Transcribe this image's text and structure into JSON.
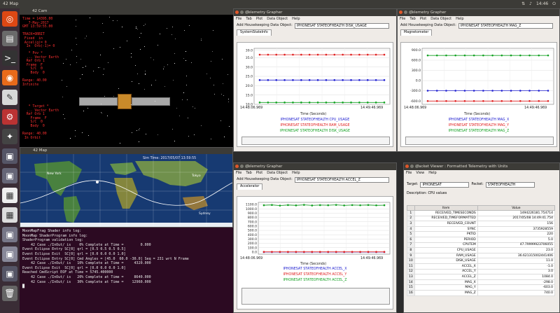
{
  "topbar": {
    "title": "42 Map",
    "clock": "14:46"
  },
  "colors": {
    "cpu": "#2020d0",
    "ram": "#e02020",
    "disk": "#10a020",
    "launcher": "#3a2d36",
    "terminal": "#2c0a22",
    "map_sea": "#173a72"
  },
  "launcher": {
    "icons": [
      "ubuntu-logo-icon",
      "files-icon",
      "terminal-icon",
      "firefox-icon",
      "text-editor-icon",
      "settings-icon",
      "tools-icon",
      "app-icon",
      "app-icon",
      "chart-icon",
      "chart-icon",
      "app-icon",
      "app-icon",
      "app-icon",
      "trash-icon"
    ]
  },
  "cam": {
    "title": "42 Cam",
    "hud_top": "Time = 14395.00\n   7-May-2017\nGMT 13:59:55.00\n\nTRACK=ORBIT\n Fixed  in\n Accel(g)= 0\n  In  Orb(-1)= 0",
    "hud_mid": "   * Pov *\n  ... Vector Earth\n  Ref Orb 1\n  Frame  F\n    S/C  0\n    Body  0\n\nRange: 40.00\nInfinite",
    "hud_low": "   * Target *\n  ... Vector Earth\n  Ref Orb 1\n    Frame  F\n    S/C  0\n    Body  0\n\nRange: 40.00\n In Orbit"
  },
  "map": {
    "title": "42 Map",
    "time_label": "Sim Time: 2017/05/07 13:59:55",
    "labels": [
      "New York",
      "Tokyo",
      "Sydney"
    ]
  },
  "terminal": {
    "lines": [
      "MoonMapFrag Shader info log:",
      "",
      "MoonMap ShaderProgram info log:",
      "",
      "ShaderProgram validation log:",
      "",
      "    42 Case ./InOut/ is    0% Complete at Time =        0.000",
      "Event Eclipse Entry SC[0] qrl = [0.5 0.5 0.5 0.5]",
      "Event Eclipse Exit  SC[0] qrl = [0.0 0.0 0.0 1.0]",
      "Event Eclipse Entry SC[0] Cmd Angles = [45.0  60.0 -30.0] Seq = 231 wrt N Frame",
      "    42 Case ./InOut/ is   10% Complete at Time =     4320.000",
      "Event Eclipse Exit  SC[0] qrl = [0.0 0.0 0.0 1.0]",
      "Reached CmdScript EOF at Time = 5745.400000",
      "    42 Case ./InOut/ is   20% Complete at Time =     8640.000",
      "    42 Case ./InOut/ is   30% Complete at Time =    12960.000"
    ]
  },
  "g1": {
    "title": "Telemetry Grapher",
    "menu": [
      "File",
      "Tab",
      "Plot",
      "Data Object",
      "Help"
    ],
    "add_label": "Add Housekeeping Data Object:",
    "add_value": "IPHONESAT STATEOFHEALTH DISK_USAGE",
    "tab": "SystemStateInfo",
    "x_start": "14:48:06.969",
    "x_end": "14:49:46.969",
    "x_title": "Time (Seconds)",
    "legend": [
      "IPHONESAT STATEOFHEALTH CPU_USAGE",
      "IPHONESAT STATEOFHEALTH RAM_USAGE",
      "IPHONESAT STATEOFHEALTH DISK_USAGE"
    ]
  },
  "g2": {
    "title": "Telemetry Grapher",
    "menu": [
      "File",
      "Tab",
      "Plot",
      "Data Object",
      "Help"
    ],
    "add_label": "Add Housekeeping Data Object:",
    "add_value": "IPHONESAT STATEOFHEALTH MAG_Z",
    "tab": "Magnetometer",
    "x_start": "14:48:06.969",
    "x_end": "14:49:46.969",
    "x_title": "Time (Seconds)",
    "legend": [
      "IPHONESAT STATEOFHEALTH MAG_X",
      "IPHONESAT STATEOFHEALTH MAG_Y",
      "IPHONESAT STATEOFHEALTH MAG_Z"
    ]
  },
  "g3": {
    "title": "Telemetry Grapher",
    "menu": [
      "File",
      "Tab",
      "Plot",
      "Data Object",
      "Help"
    ],
    "add_label": "Add Housekeeping Data Object:",
    "add_value": "IPHONESAT STATEOFHEALTH ACCEL_Z",
    "tab": "Accelerator",
    "x_start": "14:48:06.969",
    "x_end": "14:49:46.969",
    "x_title": "Time (Seconds)",
    "legend": [
      "IPHONESAT STATEOFHEALTH ACCEL_X",
      "IPHONESAT STATEOFHEALTH ACCEL_Y",
      "IPHONESAT STATEOFHEALTH ACCEL_Z"
    ]
  },
  "packet_viewer": {
    "title": "Packet Viewer : Formatted Telemetry with Units",
    "menu": [
      "File",
      "View",
      "Help"
    ],
    "target_label": "Target:",
    "target_value": "IPHONESAT",
    "packet_label": "Packet:",
    "packet_value": "STATEOFHEALTH",
    "description": "Description:  CPU values",
    "col_item": "Item",
    "col_value": "Value",
    "rows": [
      [
        "RECEIVED_TIMESECONDS",
        "1494226181.754714"
      ],
      [
        "RECEIVED_TIMEFORMATTED",
        "2017/05/08 14:49:41.754"
      ],
      [
        "RECEIVED_COUNT",
        "156"
      ],
      [
        "SYNC",
        "3735928559"
      ],
      [
        "PKTID",
        "220"
      ],
      [
        "PERIOD",
        "5.0"
      ],
      [
        "CPUTEM",
        "47.79999923706055"
      ],
      [
        "CPU_USAGE",
        "23.0"
      ],
      [
        "RAM_USAGE",
        "36.621315002441406"
      ],
      [
        "DISK_USAGE",
        "11.0"
      ],
      [
        "ACCEL_X",
        "-1.0"
      ],
      [
        "ACCEL_Y",
        "3.0"
      ],
      [
        "ACCEL_Z",
        "1084.0"
      ],
      [
        "MAG_X",
        "-298.0"
      ],
      [
        "MAG_Y",
        "-603.0"
      ],
      [
        "MAG_Z",
        "740.0"
      ]
    ]
  },
  "chart_data": [
    {
      "type": "line",
      "title": "",
      "xlabel": "Time (Seconds)",
      "ylabel": "",
      "ylim": [
        10,
        40
      ],
      "yticks": [
        10.0,
        15.0,
        20.0,
        25.0,
        30.0,
        35.0,
        39.0
      ],
      "x_range": [
        "14:48:06.969",
        "14:49:46.969"
      ],
      "series": [
        {
          "name": "IPHONESAT STATEOFHEALTH CPU_USAGE",
          "color": "#2020d0",
          "values": [
            23,
            23,
            23,
            23,
            23,
            23,
            23,
            23,
            23,
            23,
            23,
            23,
            23,
            23,
            23,
            23
          ]
        },
        {
          "name": "IPHONESAT STATEOFHEALTH RAM_USAGE",
          "color": "#e02020",
          "values": [
            36.6,
            36.6,
            36.6,
            36.6,
            36.6,
            36.6,
            36.6,
            36.6,
            36.6,
            36.6,
            36.6,
            36.6,
            36.6,
            36.6,
            36.6,
            36.6
          ]
        },
        {
          "name": "IPHONESAT STATEOFHEALTH DISK_USAGE",
          "color": "#10a020",
          "values": [
            11,
            11,
            11,
            11,
            11,
            11,
            11,
            11,
            11,
            11,
            11,
            11,
            11,
            11,
            11,
            11
          ]
        }
      ]
    },
    {
      "type": "line",
      "title": "",
      "xlabel": "Time (Seconds)",
      "ylabel": "",
      "ylim": [
        -700,
        950
      ],
      "yticks": [
        -600.0,
        -300.0,
        0.0,
        300.0,
        600.0,
        900.0
      ],
      "x_range": [
        "14:48:06.969",
        "14:49:46.969"
      ],
      "series": [
        {
          "name": "IPHONESAT STATEOFHEALTH MAG_X",
          "color": "#2020d0",
          "values": [
            -298,
            -298,
            -298,
            -298,
            -298,
            -298,
            -298,
            -298,
            -298,
            -298,
            -298,
            -298,
            -298,
            -298
          ]
        },
        {
          "name": "IPHONESAT STATEOFHEALTH MAG_Y",
          "color": "#e02020",
          "values": [
            -603,
            -603,
            -603,
            -603,
            -603,
            -603,
            -603,
            -603,
            -603,
            -603,
            -603,
            -603,
            -603,
            -603
          ]
        },
        {
          "name": "IPHONESAT STATEOFHEALTH MAG_Z",
          "color": "#10a020",
          "values": [
            740,
            740,
            740,
            740,
            740,
            740,
            740,
            740,
            740,
            740,
            740,
            740,
            740,
            740
          ]
        }
      ]
    },
    {
      "type": "line",
      "title": "",
      "xlabel": "Time (Seconds)",
      "ylabel": "",
      "ylim": [
        -50,
        1150
      ],
      "yticks": [
        0.0,
        100.0,
        200.0,
        300.0,
        400.0,
        500.0,
        600.0,
        700.0,
        800.0,
        900.0,
        1000.0,
        1100.0
      ],
      "x_range": [
        "14:48:06.969",
        "14:49:46.969"
      ],
      "series": [
        {
          "name": "IPHONESAT STATEOFHEALTH ACCEL_X",
          "color": "#2020d0",
          "values": [
            -1,
            -1,
            -1,
            -1,
            -1,
            -1,
            -1,
            -1,
            -1,
            -1,
            -1,
            -1,
            -1,
            -1,
            -1,
            -1
          ]
        },
        {
          "name": "IPHONESAT STATEOFHEALTH ACCEL_Y",
          "color": "#e02020",
          "values": [
            3,
            3,
            3,
            3,
            3,
            3,
            3,
            3,
            3,
            3,
            3,
            3,
            3,
            3,
            3,
            3
          ]
        },
        {
          "name": "IPHONESAT STATEOFHEALTH ACCEL_Z",
          "color": "#10a020",
          "values": [
            1084,
            1090,
            1075,
            1088,
            1080,
            1092,
            1078,
            1086,
            1084,
            1091,
            1079,
            1087,
            1083,
            1089,
            1081,
            1084
          ]
        }
      ]
    }
  ]
}
